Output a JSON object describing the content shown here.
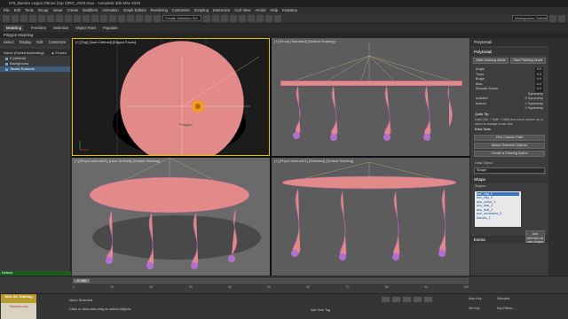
{
  "app": {
    "title": "076_Baroko Legno Ottone (top 2)RG_2020.max - Autodesk 3ds Max 2020"
  },
  "menu": [
    "File",
    "Edit",
    "Tools",
    "Group",
    "Views",
    "Create",
    "Modifiers",
    "Animation",
    "Graph Editors",
    "Rendering",
    "Customize",
    "Scripting",
    "Interactive",
    "Civil View",
    "Arnold",
    "Help",
    "Krakatoa"
  ],
  "toolbar": {
    "selection_set": "Create Selection Set",
    "workspace": "Workspaces: Default"
  },
  "ribbon": {
    "tabs": [
      "Modeling",
      "Freeform",
      "Selection",
      "Object Paint",
      "Populate"
    ],
    "active": "Modeling",
    "sub": "Polygon Modeling"
  },
  "scene_explorer": {
    "tabs": [
      "Select",
      "Display",
      "Edit",
      "Customize"
    ],
    "header": "Name (Sorted Ascending)",
    "frozen_header": "▲ Frozen",
    "items": [
      {
        "label": "0 (default)",
        "selected": false
      },
      {
        "label": "Background",
        "selected": false
      },
      {
        "label": "Tavolo Rotondo",
        "selected": true
      }
    ]
  },
  "viewports": {
    "top_left": "[+] [Top] [User Defined] [Edged Faces]",
    "top_right": "[+] [Front] [Standard] [Default Shading]",
    "bottom_left": "[+] [PhysCamera001] [User Defined] [Default Shading]",
    "bottom_right": "[+] [PhysCamera001] [Standard] [Default Shading]",
    "cursor_label": "Polygon"
  },
  "command_panel": {
    "object_name": "PolyDetail",
    "modifier": "PolyDetail",
    "buttons": [
      "Start Drawing Mode",
      "Start Painting Mode"
    ],
    "params": [
      {
        "label": "Angle",
        "value": "0.0"
      },
      {
        "label": "Twist",
        "value": "0.0"
      },
      {
        "label": "Bulge",
        "value": "0.0"
      },
      {
        "label": "Bias",
        "value": "0.0"
      },
      {
        "label": "Smooth Stroke",
        "value": "0.0"
      }
    ],
    "symmetry_label": "Symmetry",
    "symmetry_rows": [
      {
        "label": "enabled",
        "value": "X Symmetry"
      },
      {
        "label": "bottom",
        "value": "Y Symmetry"
      }
    ],
    "symmetry_extra": "Z Symmetry",
    "quick_tip_title": "Quick Tip:",
    "quick_tip": "Hold (Ctrl + Shift + LMB) and move mouse up or down to change brush size.",
    "extra_title": "Extra Tools",
    "extra_buttons": [
      "Pick Custom Path",
      "Attach Selected Objects",
      "Create a Drawing Spline"
    ],
    "draw_object_label": "Draw Object",
    "draw_object_value": "Shape",
    "shape_rollout": "Shape",
    "shapes_label": "Shapes",
    "shapes": [
      {
        "label": "acc_clip_1",
        "selected": true
      },
      {
        "label": "acc_clip_2",
        "selected": false
      },
      {
        "label": "acc_curve_1",
        "selected": false
      },
      {
        "label": "acc_leaf_1",
        "selected": false
      },
      {
        "label": "acc_leaf_2",
        "selected": false
      },
      {
        "label": "acc_ornament_3",
        "selected": false
      },
      {
        "label": "baroko_1",
        "selected": false
      }
    ],
    "add_selection": "Add selection as new shapes",
    "extras_rollout": "Extras"
  },
  "timeline": {
    "frame_label": "0 / 100",
    "ticks": [
      "0",
      "10",
      "20",
      "30",
      "40",
      "50",
      "60",
      "70",
      "80",
      "90",
      "100"
    ]
  },
  "status": {
    "default_label": "Default",
    "selection": "None Selected",
    "hint": "Click or click-and-drag to select objects",
    "logo_top": "Web 3D Training",
    "logo_bottom": "Tutorials.com",
    "add_time_tag": "Add Time Tag",
    "auto_key": "Auto Key",
    "selected": "Selected",
    "set_key": "Set Key",
    "key_filters": "Key Filters..."
  }
}
